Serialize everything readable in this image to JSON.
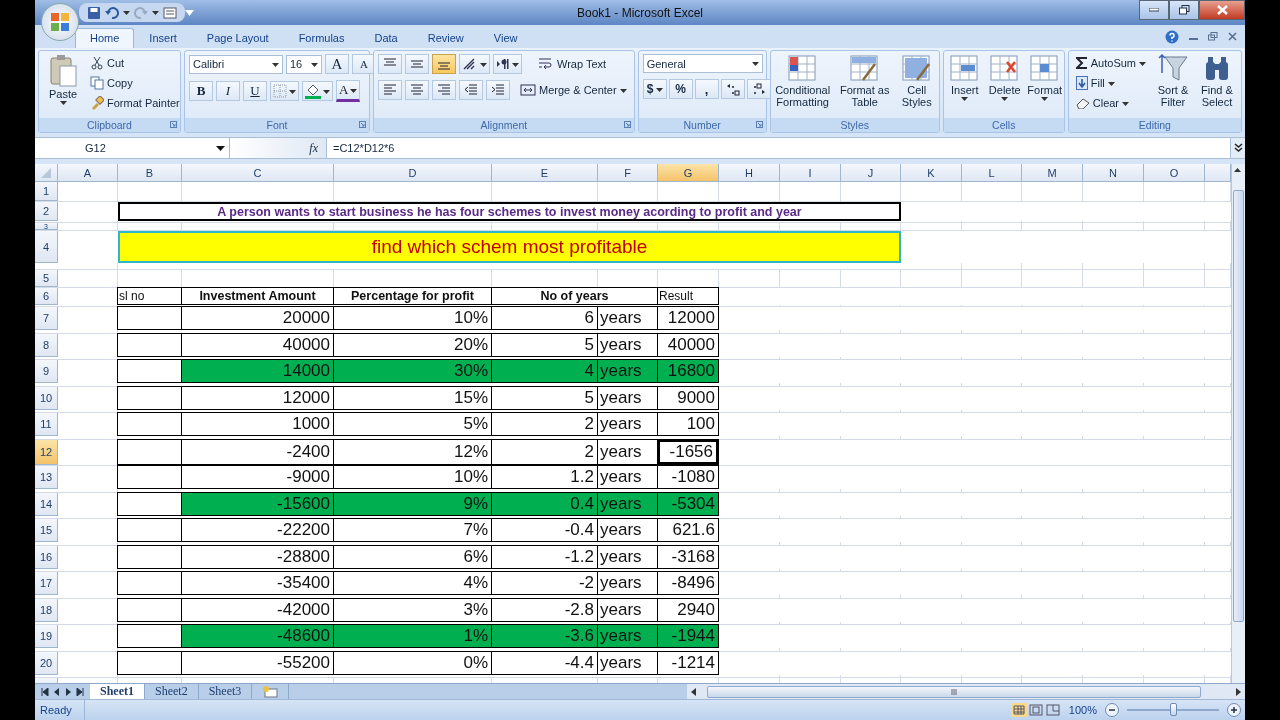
{
  "window": {
    "title": "Book1 - Microsoft Excel"
  },
  "tabs": [
    {
      "label": "Home",
      "selected": true
    },
    {
      "label": "Insert",
      "selected": false
    },
    {
      "label": "Page Layout",
      "selected": false
    },
    {
      "label": "Formulas",
      "selected": false
    },
    {
      "label": "Data",
      "selected": false
    },
    {
      "label": "Review",
      "selected": false
    },
    {
      "label": "View",
      "selected": false
    }
  ],
  "ribbon": {
    "clipboard": {
      "label": "Clipboard",
      "paste": "Paste",
      "cut": "Cut",
      "copy": "Copy",
      "format_painter": "Format Painter"
    },
    "font": {
      "label": "Font",
      "family": "Calibri",
      "size": "16",
      "grow": "A",
      "shrink": "A",
      "bold": "B",
      "italic": "I",
      "underline": "U",
      "font_color": "A"
    },
    "alignment": {
      "label": "Alignment",
      "vertical": [
        {
          "selected": false
        },
        {
          "selected": false
        },
        {
          "selected": true
        }
      ],
      "wrap_text": "Wrap Text",
      "merge_center": "Merge & Center"
    },
    "number": {
      "label": "Number",
      "format": "General",
      "currency": "$",
      "percent": "%",
      "comma": ","
    },
    "styles": {
      "label": "Styles",
      "buttons": [
        "Conditional Formatting",
        "Format as Table",
        "Cell Styles"
      ]
    },
    "cells": {
      "label": "Cells",
      "buttons": [
        "Insert",
        "Delete",
        "Format"
      ]
    },
    "editing": {
      "label": "Editing",
      "autosum": "AutoSum",
      "fill": "Fill",
      "clear": "Clear",
      "sort_filter": "Sort & Filter",
      "find_select": "Find & Select"
    }
  },
  "formula_bar": {
    "name_box": "G12",
    "fx": "fx",
    "formula": "=C12*D12*6"
  },
  "columns": [
    {
      "label": "A",
      "selected": false
    },
    {
      "label": "B",
      "selected": false
    },
    {
      "label": "C",
      "selected": false
    },
    {
      "label": "D",
      "selected": false
    },
    {
      "label": "E",
      "selected": false
    },
    {
      "label": "F",
      "selected": false
    },
    {
      "label": "G",
      "selected": true
    },
    {
      "label": "H",
      "selected": false
    },
    {
      "label": "I",
      "selected": false
    },
    {
      "label": "J",
      "selected": false
    },
    {
      "label": "K",
      "selected": false
    },
    {
      "label": "L",
      "selected": false
    },
    {
      "label": "M",
      "selected": false
    },
    {
      "label": "N",
      "selected": false
    },
    {
      "label": "O",
      "selected": false
    }
  ],
  "row_headers": [
    {
      "label": "1",
      "selected": false
    },
    {
      "label": "2",
      "selected": false
    },
    {
      "label": "3",
      "selected": false
    },
    {
      "label": "4",
      "selected": false
    },
    {
      "label": "5",
      "selected": false
    },
    {
      "label": "6",
      "selected": false
    },
    {
      "label": "7",
      "selected": false
    },
    {
      "label": "8",
      "selected": false
    },
    {
      "label": "9",
      "selected": false
    },
    {
      "label": "10",
      "selected": false
    },
    {
      "label": "11",
      "selected": false
    },
    {
      "label": "12",
      "selected": true
    },
    {
      "label": "13",
      "selected": false
    },
    {
      "label": "14",
      "selected": false
    },
    {
      "label": "15",
      "selected": false
    },
    {
      "label": "16",
      "selected": false
    },
    {
      "label": "17",
      "selected": false
    },
    {
      "label": "18",
      "selected": false
    },
    {
      "label": "19",
      "selected": false
    },
    {
      "label": "20",
      "selected": false
    }
  ],
  "sheet": {
    "note": "A person wants to start business he has four schemes to invest money acording to profit and year",
    "heading": "find which schem most profitable",
    "headers": [
      "sl no",
      "Investment Amount",
      "Percentage for profit",
      "No of years",
      "Result"
    ],
    "rows": [
      {
        "amount": "20000",
        "percent": "10%",
        "years": "6",
        "unit": "years",
        "result": "12000",
        "highlighted": false,
        "selected": false
      },
      {
        "amount": "40000",
        "percent": "20%",
        "years": "5",
        "unit": "years",
        "result": "40000",
        "highlighted": false,
        "selected": false
      },
      {
        "amount": "14000",
        "percent": "30%",
        "years": "4",
        "unit": "years",
        "result": "16800",
        "highlighted": true,
        "selected": false
      },
      {
        "amount": "12000",
        "percent": "15%",
        "years": "5",
        "unit": "years",
        "result": "9000",
        "highlighted": false,
        "selected": false
      },
      {
        "amount": "1000",
        "percent": "5%",
        "years": "2",
        "unit": "years",
        "result": "100",
        "highlighted": false,
        "selected": false
      },
      {
        "amount": "-2400",
        "percent": "12%",
        "years": "2",
        "unit": "years",
        "result": "-1656",
        "highlighted": false,
        "selected": true
      },
      {
        "amount": "-9000",
        "percent": "10%",
        "years": "1.2",
        "unit": "years",
        "result": "-1080",
        "highlighted": false,
        "selected": false
      },
      {
        "amount": "-15600",
        "percent": "9%",
        "years": "0.4",
        "unit": "years",
        "result": "-5304",
        "highlighted": true,
        "selected": false
      },
      {
        "amount": "-22200",
        "percent": "7%",
        "years": "-0.4",
        "unit": "years",
        "result": "621.6",
        "highlighted": false,
        "selected": false
      },
      {
        "amount": "-28800",
        "percent": "6%",
        "years": "-1.2",
        "unit": "years",
        "result": "-3168",
        "highlighted": false,
        "selected": false
      },
      {
        "amount": "-35400",
        "percent": "4%",
        "years": "-2",
        "unit": "years",
        "result": "-8496",
        "highlighted": false,
        "selected": false
      },
      {
        "amount": "-42000",
        "percent": "3%",
        "years": "-2.8",
        "unit": "years",
        "result": "2940",
        "highlighted": false,
        "selected": false
      },
      {
        "amount": "-48600",
        "percent": "1%",
        "years": "-3.6",
        "unit": "years",
        "result": "-1944",
        "highlighted": true,
        "selected": false
      },
      {
        "amount": "-55200",
        "percent": "0%",
        "years": "-4.4",
        "unit": "years",
        "result": "-1214",
        "highlighted": false,
        "selected": false
      }
    ]
  },
  "sheet_tabs": [
    {
      "label": "Sheet1",
      "selected": true
    },
    {
      "label": "Sheet2",
      "selected": false
    },
    {
      "label": "Sheet3",
      "selected": false
    }
  ],
  "status_bar": {
    "state": "Ready",
    "zoom": "100%",
    "zoom_slider": {
      "level": 0.5
    }
  }
}
